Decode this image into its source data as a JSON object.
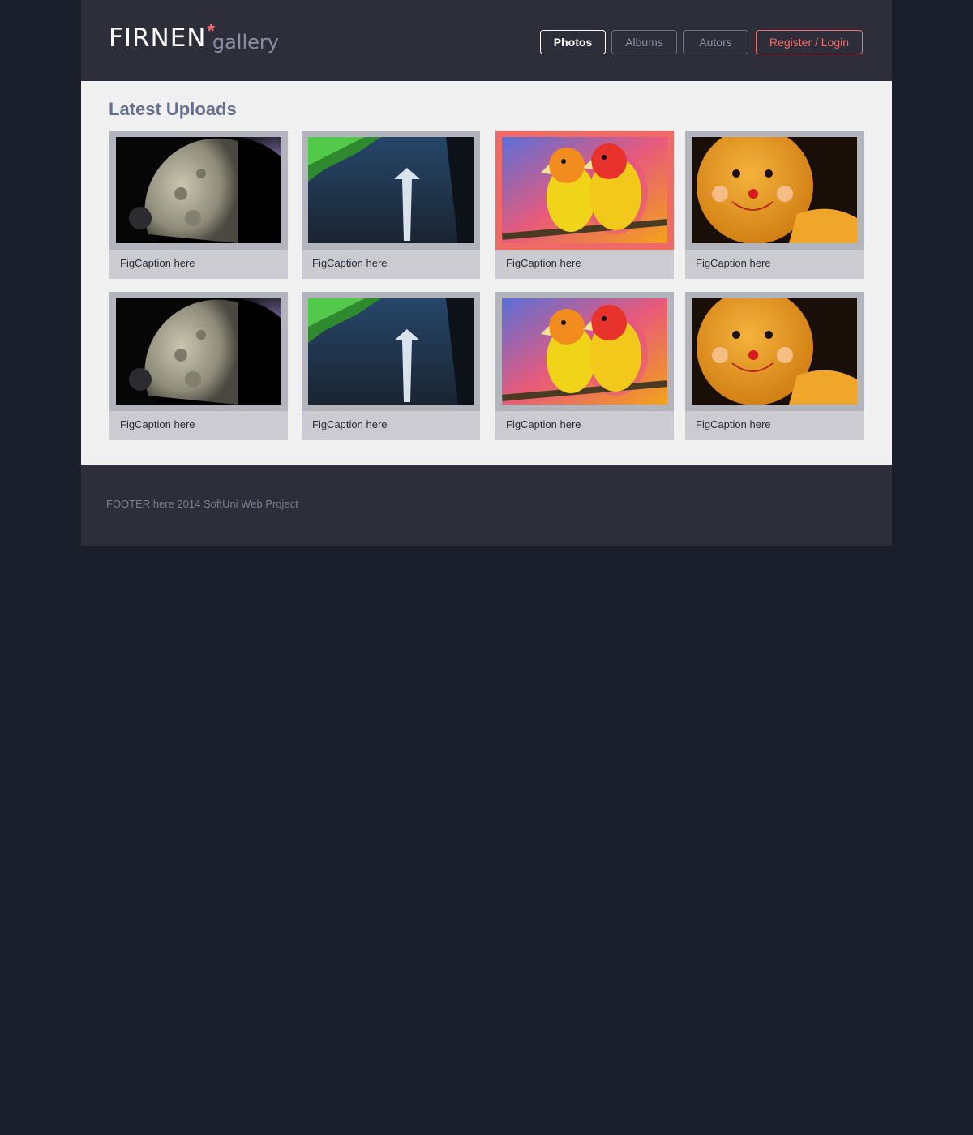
{
  "header": {
    "logo_main": "FIRNEN",
    "logo_star": "*",
    "logo_sub": "gallery",
    "nav": [
      {
        "label": "Photos",
        "active": true
      },
      {
        "label": "Albums",
        "active": false
      },
      {
        "label": "Autors",
        "active": false
      }
    ],
    "auth_label": "Register  / Login"
  },
  "main": {
    "title": "Latest Uploads",
    "cards": [
      {
        "caption": "FigCaption here",
        "image": "moon-image",
        "highlighted": false
      },
      {
        "caption": "FigCaption here",
        "image": "road-arrow-image",
        "highlighted": false
      },
      {
        "caption": "FigCaption here",
        "image": "parrots-image",
        "highlighted": true
      },
      {
        "caption": "FigCaption here",
        "image": "cookie-face-image",
        "highlighted": false
      },
      {
        "caption": "FigCaption here",
        "image": "moon-image",
        "highlighted": false
      },
      {
        "caption": "FigCaption here",
        "image": "road-arrow-image",
        "highlighted": false
      },
      {
        "caption": "FigCaption here",
        "image": "parrots-image",
        "highlighted": false
      },
      {
        "caption": "FigCaption here",
        "image": "cookie-face-image",
        "highlighted": false
      }
    ]
  },
  "footer": {
    "text": "FOOTER here  2014 SoftUni Web Project"
  },
  "colors": {
    "page_bg": "#1b1e2b",
    "header_bg": "#2d2e39",
    "main_bg": "#f0f0f0",
    "accent": "#f26a6a",
    "title": "#68708f"
  }
}
